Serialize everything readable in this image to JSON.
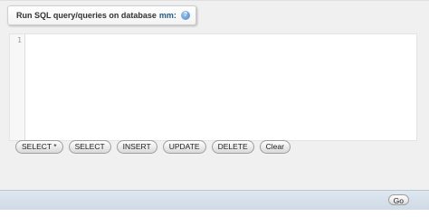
{
  "sql_box": {
    "legend": {
      "prefix": "Run SQL query/queries on database",
      "database": "mm:",
      "help_icon": "help-icon"
    },
    "editor": {
      "line_number": "1",
      "content": ""
    }
  },
  "toolbar": {
    "buttons": [
      {
        "label": "SELECT *"
      },
      {
        "label": "SELECT"
      },
      {
        "label": "INSERT"
      },
      {
        "label": "UPDATE"
      },
      {
        "label": "DELETE"
      },
      {
        "label": "Clear"
      }
    ]
  },
  "footer": {
    "go_label": "Go"
  },
  "colors": {
    "panel_bg": "#f0f0f0",
    "footer_bg": "#d4dee9",
    "db_name": "#235a81"
  }
}
